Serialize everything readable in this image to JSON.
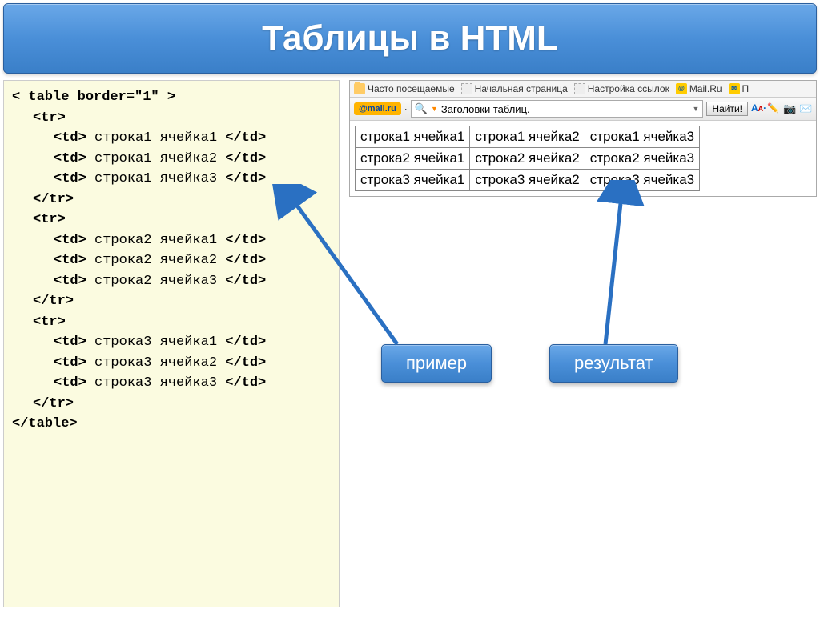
{
  "title": "Таблицы в HTML",
  "code": {
    "table_open": "< table border=\"1\" >",
    "tr_open": "<tr>",
    "tr_close": "</tr>",
    "td_open": "<td>",
    "td_close": "</td>",
    "table_close": "</table>",
    "cells": [
      [
        "строка1 ячейка1",
        "строка1 ячейка2",
        "строка1 ячейка3"
      ],
      [
        "строка2 ячейка1",
        "строка2 ячейка2",
        "строка2 ячейка3"
      ],
      [
        "строка3 ячейка1",
        "строка3 ячейка2",
        "строка3 ячейка3"
      ]
    ]
  },
  "browser": {
    "bookmarks": {
      "frequent": "Часто посещаемые",
      "start": "Начальная страница",
      "links": "Настройка ссылок",
      "mail": "Mail.Ru",
      "extra": "П"
    },
    "search": {
      "logo": "@mail.ru",
      "value": "Заголовки таблиц.",
      "button": "Найти!"
    }
  },
  "result_table": [
    [
      "строка1 ячейка1",
      "строка1 ячейка2",
      "строка1 ячейка3"
    ],
    [
      "строка2 ячейка1",
      "строка2 ячейка2",
      "строка2 ячейка3"
    ],
    [
      "строка3 ячейка1",
      "строка3 ячейка2",
      "строка3 ячейка3"
    ]
  ],
  "callouts": {
    "example": "пример",
    "result": "результат"
  }
}
